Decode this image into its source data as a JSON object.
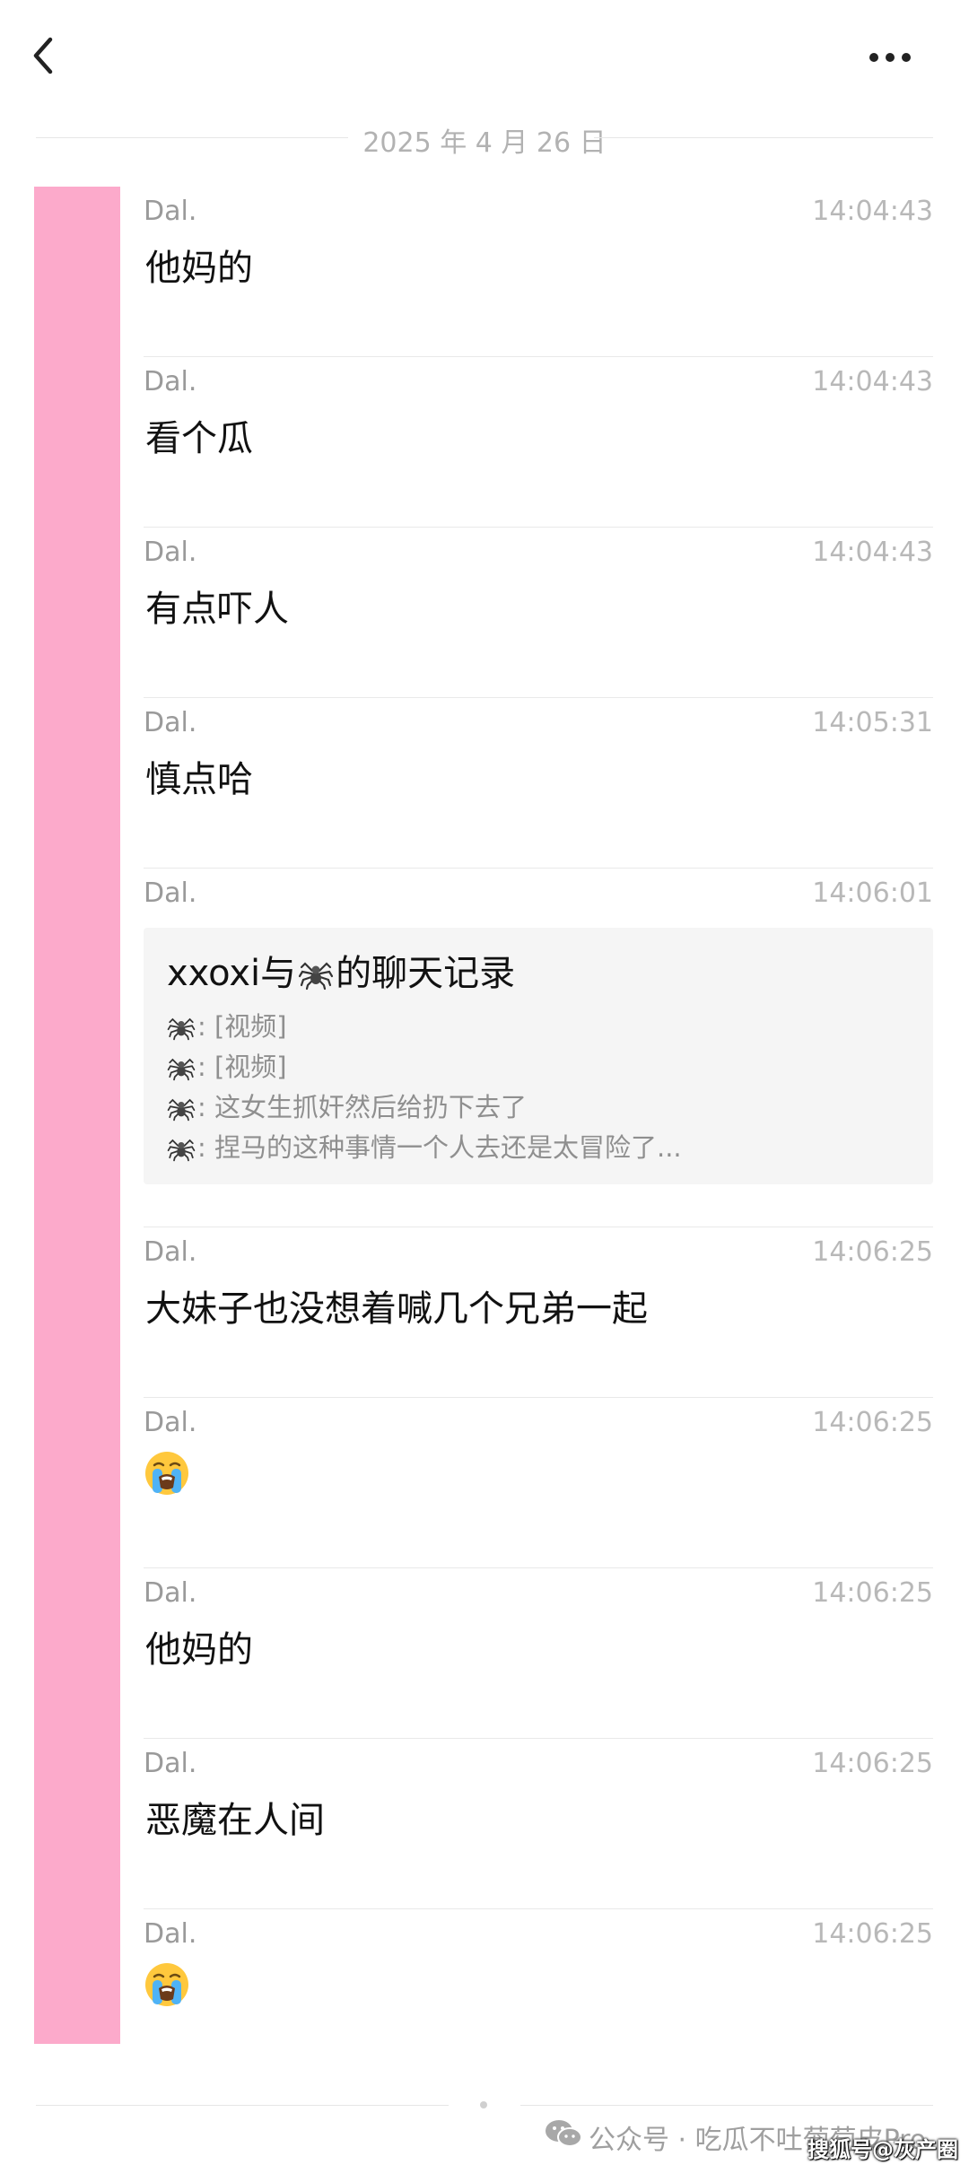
{
  "header": {
    "back_icon": "chevron-left-icon",
    "more_icon": "more-horizontal-icon"
  },
  "date_divider": "2025 年 4 月 26 日",
  "accent_color": "#fcaacb",
  "messages": [
    {
      "sender": "Dal.",
      "time": "14:04:43",
      "type": "text",
      "text": "他妈的"
    },
    {
      "sender": "Dal.",
      "time": "14:04:43",
      "type": "text",
      "text": "看个瓜"
    },
    {
      "sender": "Dal.",
      "time": "14:04:43",
      "type": "text",
      "text": "有点吓人"
    },
    {
      "sender": "Dal.",
      "time": "14:05:31",
      "type": "text",
      "text": "慎点哈"
    },
    {
      "sender": "Dal.",
      "time": "14:06:01",
      "type": "chat-record"
    },
    {
      "sender": "Dal.",
      "time": "14:06:25",
      "type": "text",
      "text": "大妹子也没想着喊几个兄弟一起"
    },
    {
      "sender": "Dal.",
      "time": "14:06:25",
      "type": "emoji",
      "emoji": "loudly-crying-face-icon"
    },
    {
      "sender": "Dal.",
      "time": "14:06:25",
      "type": "text",
      "text": "他妈的"
    },
    {
      "sender": "Dal.",
      "time": "14:06:25",
      "type": "text",
      "text": "恶魔在人间"
    },
    {
      "sender": "Dal.",
      "time": "14:06:25",
      "type": "emoji",
      "emoji": "loudly-crying-face-icon"
    }
  ],
  "chat_record": {
    "title_prefix": "xxoxi与",
    "title_suffix": "的聊天记录",
    "avatar_icon": "spider-icon",
    "lines": [
      ": [视频]",
      ": [视频]",
      ": 这女生抓奸然后给扔下去了",
      ": 捏马的这种事情一个人去还是太冒险了..."
    ]
  },
  "watermark": {
    "wechat_icon": "wechat-icon",
    "text": "公众号 · 吃瓜不吐葡萄皮Pro",
    "sohu_text": "搜狐号@灰产圈"
  }
}
